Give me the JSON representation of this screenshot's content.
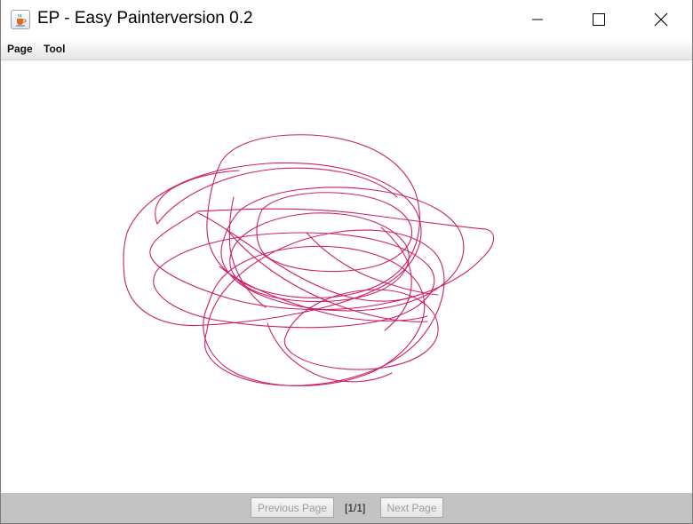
{
  "window": {
    "title": "EP - Easy Painterversion 0.2",
    "app_icon": "java-cup-icon",
    "controls": [
      "minimize-icon",
      "maximize-icon",
      "close-icon"
    ]
  },
  "menubar": {
    "items": [
      {
        "label": "Page"
      },
      {
        "label": "Tool"
      }
    ]
  },
  "canvas": {
    "stroke_color": "#cc1f6a",
    "background": "#ffffff"
  },
  "pager": {
    "previous_label": "Previous Page",
    "indicator": "[1/1]",
    "next_label": "Next Page",
    "previous_enabled": false,
    "next_enabled": false
  }
}
